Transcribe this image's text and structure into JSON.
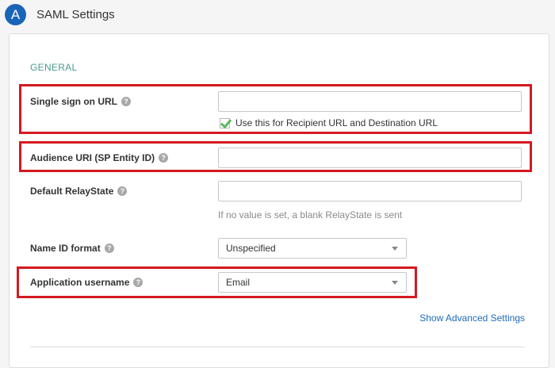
{
  "header": {
    "step_letter": "A",
    "title": "SAML Settings"
  },
  "section": {
    "title": "GENERAL"
  },
  "fields": {
    "sso_url": {
      "label": "Single sign on URL",
      "value": "",
      "checkbox_label": "Use this for Recipient URL and Destination URL",
      "checkbox_checked": true
    },
    "audience_uri": {
      "label": "Audience URI (SP Entity ID)",
      "value": ""
    },
    "relay_state": {
      "label": "Default RelayState",
      "value": "",
      "hint": "If no value is set, a blank RelayState is sent"
    },
    "name_id_format": {
      "label": "Name ID format",
      "selected": "Unspecified"
    },
    "app_username": {
      "label": "Application username",
      "selected": "Email"
    }
  },
  "help_glyph": "?",
  "advanced_link": "Show Advanced Settings",
  "colors": {
    "badge": "#1a64b8",
    "section_title": "#4c9c8c",
    "link": "#1f6bbf",
    "highlight": "#d41920",
    "checkmark": "#5cb85c"
  }
}
